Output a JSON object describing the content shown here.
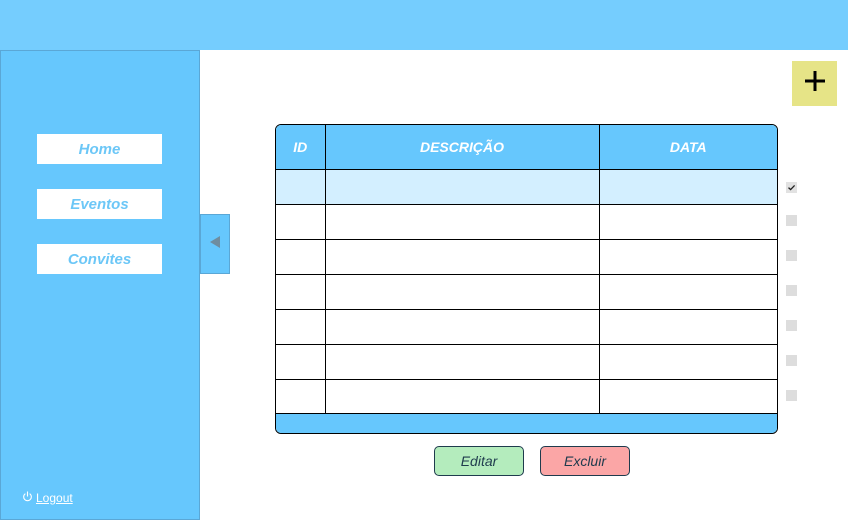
{
  "sidebar": {
    "items": [
      {
        "label": "Home"
      },
      {
        "label": "Eventos"
      },
      {
        "label": "Convites"
      }
    ],
    "logout_label": "Logout"
  },
  "table": {
    "headers": [
      "ID",
      "DESCRIÇÃO",
      "DATA"
    ],
    "rows": [
      {
        "id": "",
        "descricao": "",
        "data": "",
        "selected": true
      },
      {
        "id": "",
        "descricao": "",
        "data": ""
      },
      {
        "id": "",
        "descricao": "",
        "data": ""
      },
      {
        "id": "",
        "descricao": "",
        "data": ""
      },
      {
        "id": "",
        "descricao": "",
        "data": ""
      },
      {
        "id": "",
        "descricao": "",
        "data": ""
      },
      {
        "id": "",
        "descricao": "",
        "data": ""
      }
    ],
    "row_checked": [
      true,
      false,
      false,
      false,
      false,
      false,
      false
    ]
  },
  "actions": {
    "add_label": "+",
    "edit_label": "Editar",
    "delete_label": "Excluir"
  },
  "icons": {
    "collapse": "chevron-left-icon",
    "power": "power-icon",
    "check": "check-icon",
    "add": "plus-icon"
  },
  "colors": {
    "topbar": "#75cdfe",
    "sidebar": "#66c7fd",
    "header": "#66c7fd",
    "selected_row": "#d3efff",
    "add_button": "#e6e487",
    "edit_button": "#b4ecbd",
    "delete_button": "#fba6a6"
  }
}
